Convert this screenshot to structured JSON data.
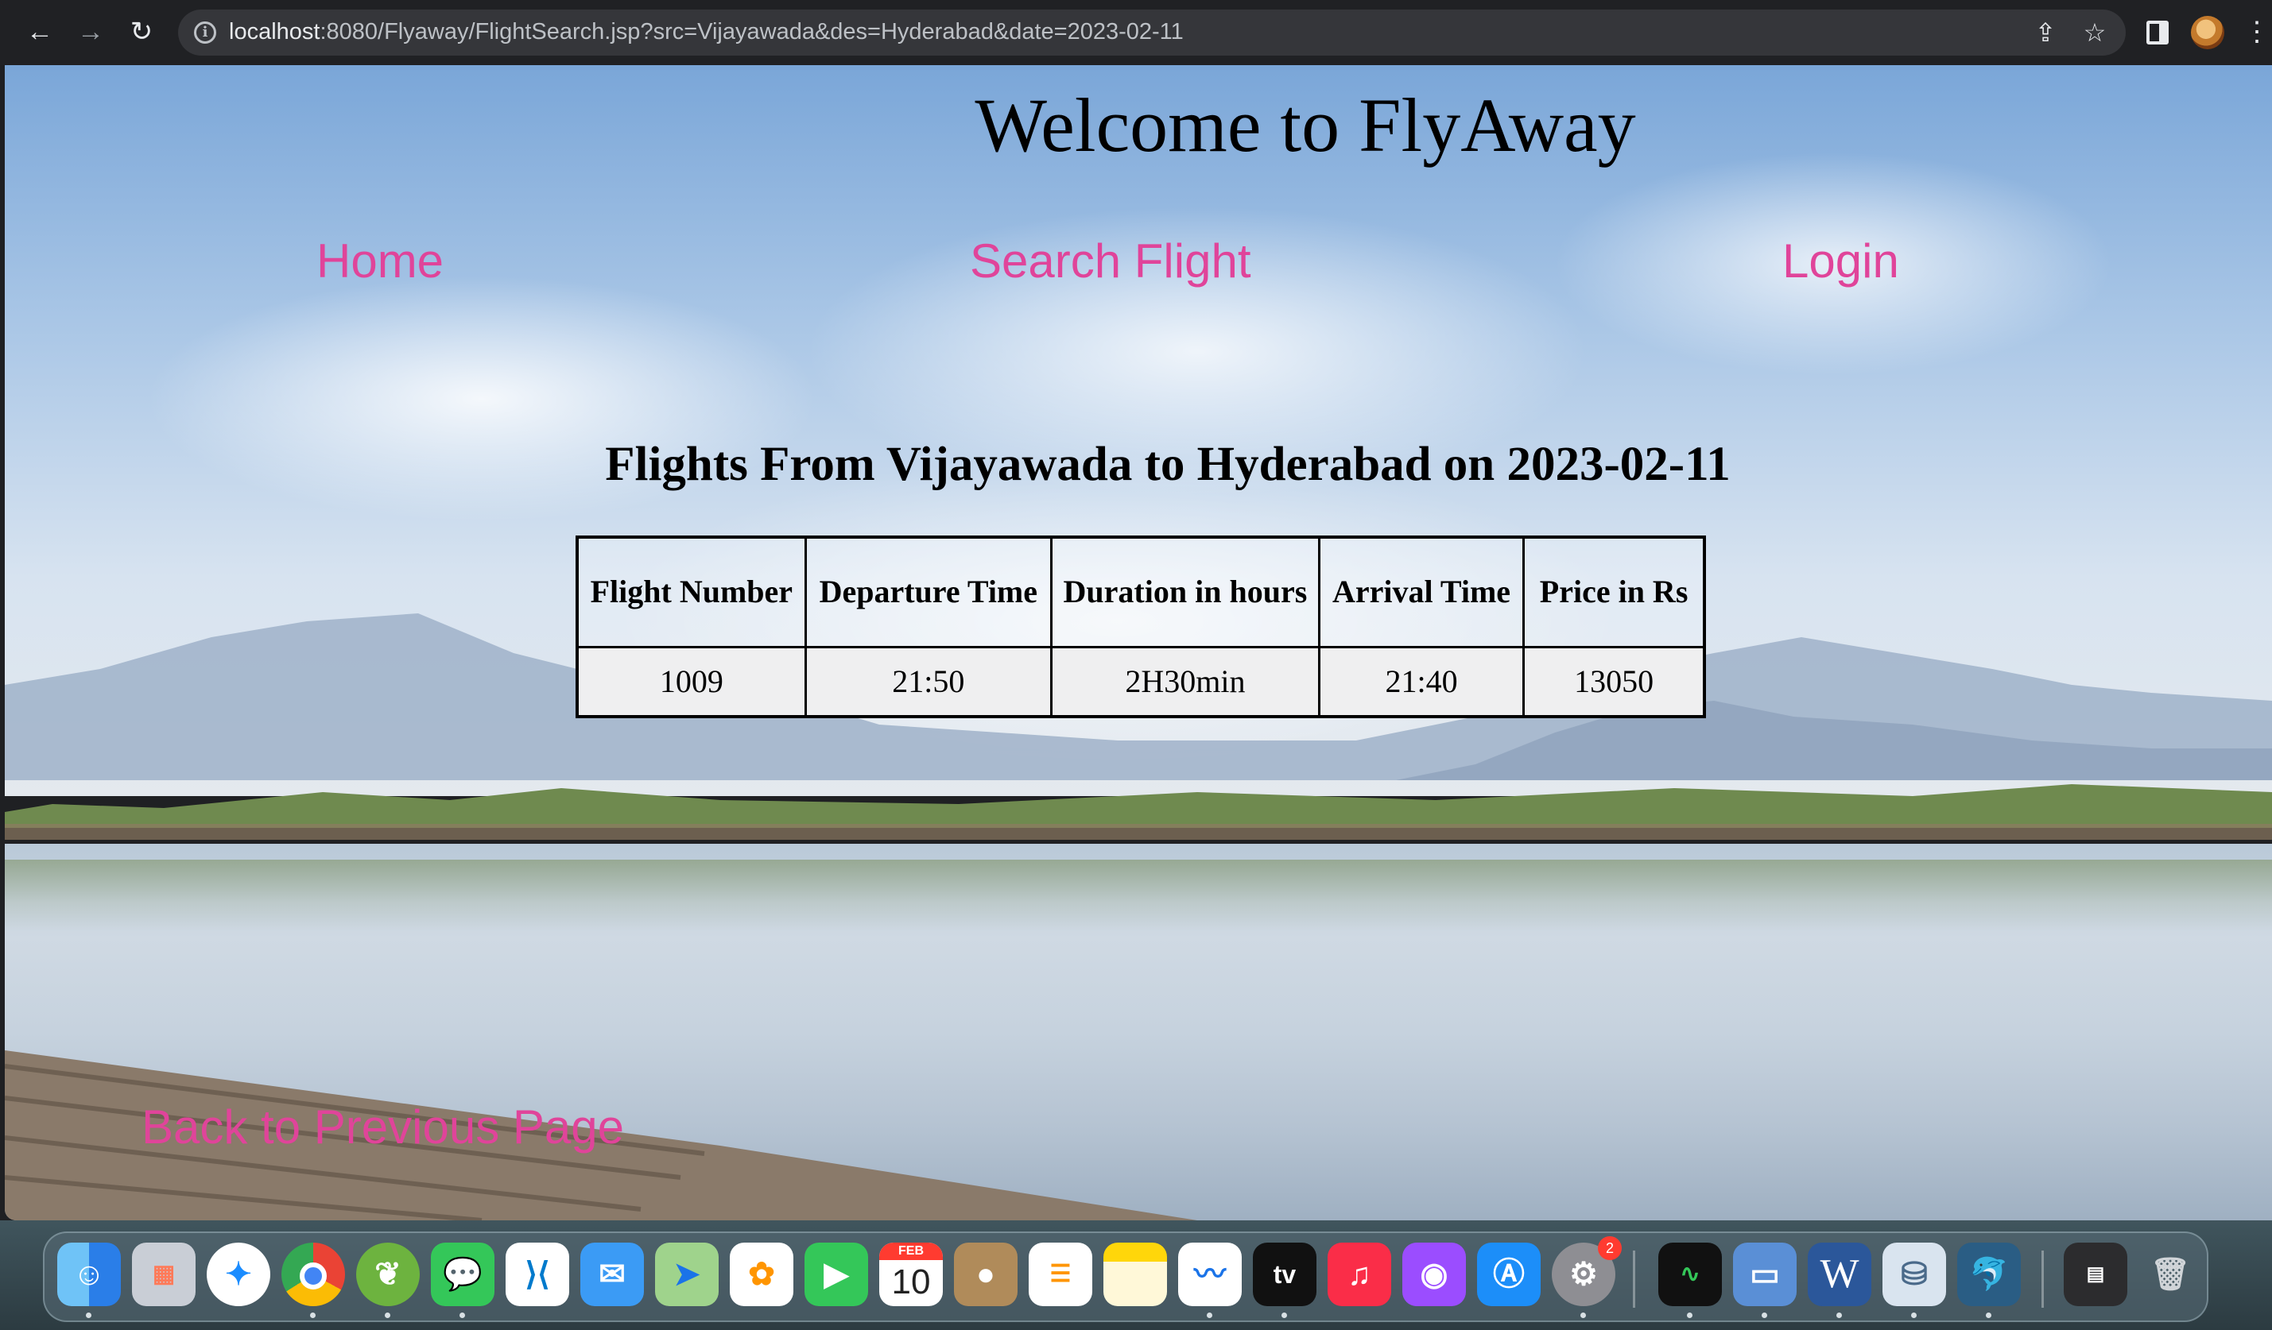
{
  "browser": {
    "url_host": "localhost",
    "url_rest": ":8080/Flyaway/FlightSearch.jsp?src=Vijayawada&des=Hyderabad&date=2023-02-11",
    "back_icon": "←",
    "forward_icon": "→",
    "reload_icon": "↻",
    "share_icon": "⇪",
    "bookmark_icon": "☆",
    "menu_icon": "⋮"
  },
  "page": {
    "title": "Welcome to FlyAway",
    "nav": {
      "home": "Home",
      "search": "Search Flight",
      "login": "Login"
    },
    "results_heading": "Flights From Vijayawada to Hyderabad on 2023-02-11",
    "table": {
      "headers": [
        "Flight Number",
        "Departure Time",
        "Duration in hours",
        "Arrival Time",
        "Price in Rs"
      ],
      "rows": [
        [
          "1009",
          "21:50",
          "2H30min",
          "21:40",
          "13050"
        ]
      ]
    },
    "back_link": "Back to Previous Page",
    "link_color": "#e0449a"
  },
  "dock": {
    "calendar_month": "FEB",
    "calendar_day": "10",
    "settings_badge": "2",
    "tv_label": "tv",
    "word_label": "W"
  }
}
